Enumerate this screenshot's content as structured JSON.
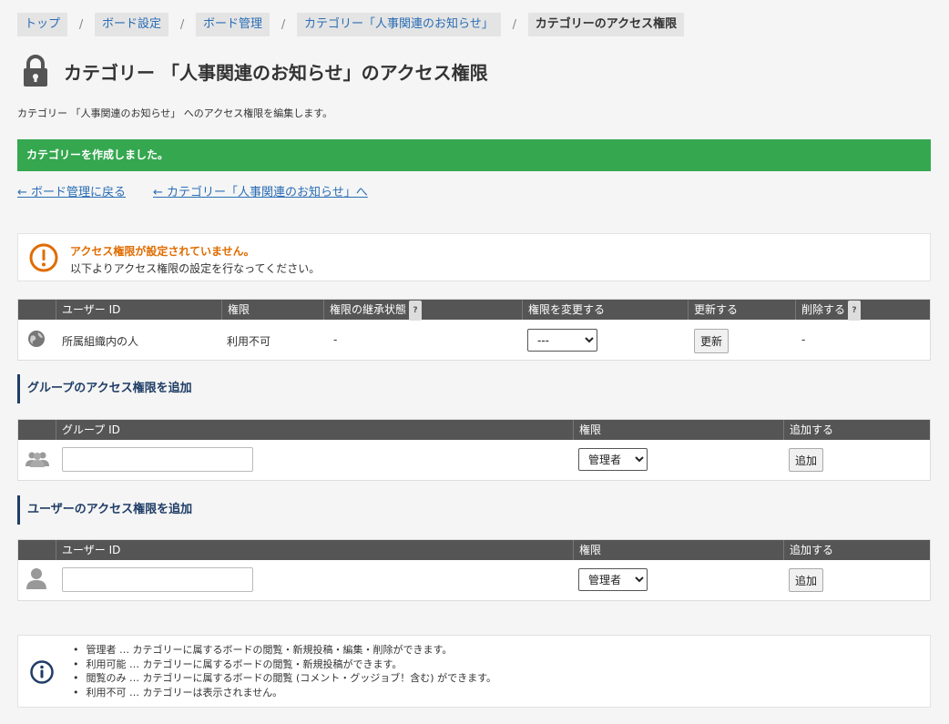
{
  "breadcrumb": {
    "items": [
      "トップ",
      "ボード設定",
      "ボード管理",
      "カテゴリー「人事関連のお知らせ」",
      "カテゴリーのアクセス権限"
    ],
    "separator": "/"
  },
  "header": {
    "title": "カテゴリー 「人事関連のお知らせ」のアクセス権限",
    "description": "カテゴリー 「人事関連のお知らせ」 へのアクセス権限を編集します。"
  },
  "alert_success": "カテゴリーを作成しました。",
  "links": {
    "back_board": "← ボード管理に戻る",
    "back_category": "← カテゴリー「人事関連のお知らせ」へ"
  },
  "warning": {
    "title": "アクセス権限が設定されていません。",
    "message": "以下よりアクセス権限の設定を行なってください。"
  },
  "perm_table": {
    "headers": [
      "ユーザー ID",
      "権限",
      "権限の継承状態",
      "権限を変更する",
      "更新する",
      "削除する"
    ],
    "row": {
      "name": "所属組織内の人",
      "permission": "利用不可",
      "inherit": "-",
      "select_value": "---",
      "update_label": "更新",
      "delete": "-"
    }
  },
  "group_section": {
    "title": "グループのアクセス権限を追加",
    "headers": [
      "グループ ID",
      "権限",
      "追加する"
    ],
    "select_value": "管理者",
    "add_label": "追加"
  },
  "user_section": {
    "title": "ユーザーのアクセス権限を追加",
    "headers": [
      "ユーザー ID",
      "権限",
      "追加する"
    ],
    "select_value": "管理者",
    "add_label": "追加"
  },
  "info": {
    "items": [
      "管理者 … カテゴリーに属するボードの閲覧・新規投稿・編集・削除ができます。",
      "利用可能 … カテゴリーに属するボードの閲覧・新規投稿ができます。",
      "閲覧のみ … カテゴリーに属するボードの閲覧 (コメント・グッジョブ！含む) ができます。",
      "利用不可 … カテゴリーは表示されません。"
    ]
  },
  "colors": {
    "success": "#34a74f",
    "warning": "#e06c00",
    "link": "#2a6db5",
    "header_bg": "#555555",
    "section_accent": "#1f3d66"
  },
  "icons": {
    "title": "lock-icon",
    "warning": "exclamation-circle-icon",
    "org": "globe-icon",
    "group": "group-icon",
    "user": "user-icon",
    "info": "info-circle-icon"
  }
}
